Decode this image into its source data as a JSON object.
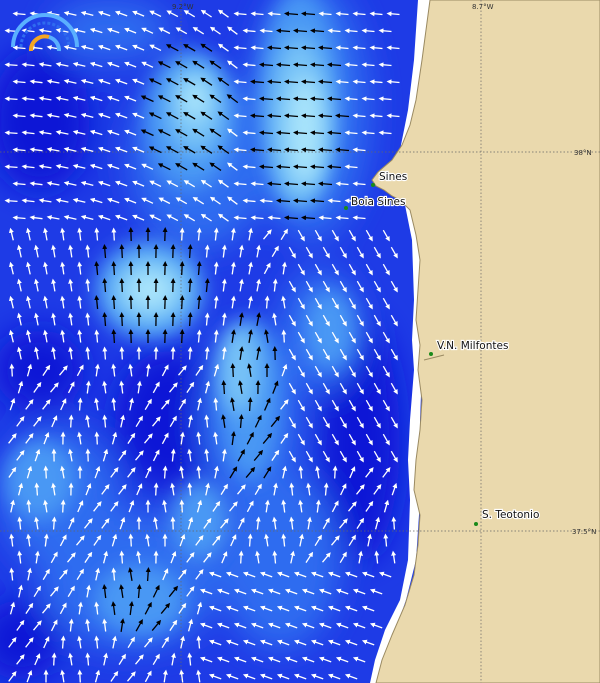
{
  "map": {
    "colors": {
      "land": "#ead9ad",
      "coast": "#9a8a62",
      "ocean_deep": "#0a12d6",
      "ocean_1": "#1e3be6",
      "ocean_2": "#2f6cf0",
      "ocean_3": "#4a98f4",
      "ocean_4": "#77c2f7",
      "ocean_5": "#a9e4fb",
      "gap": "#ffffff",
      "gridline": "#666666",
      "arrow_strong": "#000000",
      "arrow_weak": "#ffffff",
      "place_dot": "#1a8a1a"
    },
    "longitude_labels": [
      "9.2°W",
      "8.7°W"
    ],
    "latitude_labels": [
      "38°N",
      "37.5°N"
    ],
    "places": [
      {
        "id": "sines",
        "name": "Sines"
      },
      {
        "id": "boia-sines",
        "name": "Boia Sines"
      },
      {
        "id": "vn-milfontes",
        "name": "V.N. Milfontes"
      },
      {
        "id": "s-teotonio",
        "name": "S. Teotonio"
      }
    ],
    "logo_icon": "gauge-logo-icon"
  }
}
